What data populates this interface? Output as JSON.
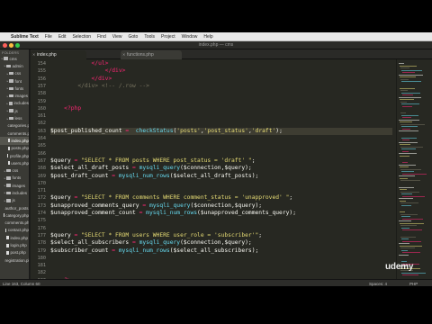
{
  "menubar": {
    "apple": "",
    "items": [
      "Sublime Text",
      "File",
      "Edit",
      "Selection",
      "Find",
      "View",
      "Goto",
      "Tools",
      "Project",
      "Window",
      "Help"
    ]
  },
  "window": {
    "title": "index.php — cms"
  },
  "sidebar": {
    "header": "FOLDERS",
    "items": [
      {
        "label": "cms",
        "kind": "folder",
        "depth": 0,
        "selected": false
      },
      {
        "label": "admin",
        "kind": "folder",
        "depth": 1,
        "selected": false
      },
      {
        "label": "css",
        "kind": "folder",
        "depth": 2,
        "selected": false
      },
      {
        "label": "font",
        "kind": "folder",
        "depth": 2,
        "selected": false
      },
      {
        "label": "fonts",
        "kind": "folder",
        "depth": 2,
        "selected": false
      },
      {
        "label": "images",
        "kind": "folder",
        "depth": 2,
        "selected": false
      },
      {
        "label": "includes",
        "kind": "folder",
        "depth": 2,
        "selected": false
      },
      {
        "label": "js",
        "kind": "folder",
        "depth": 2,
        "selected": false
      },
      {
        "label": "less",
        "kind": "folder",
        "depth": 2,
        "selected": false
      },
      {
        "label": "categories.php",
        "kind": "file",
        "depth": 2,
        "selected": false
      },
      {
        "label": "comments.php",
        "kind": "file",
        "depth": 2,
        "selected": false
      },
      {
        "label": "index.php",
        "kind": "file",
        "depth": 2,
        "selected": true
      },
      {
        "label": "posts.php",
        "kind": "file",
        "depth": 2,
        "selected": false
      },
      {
        "label": "profile.php",
        "kind": "file",
        "depth": 2,
        "selected": false
      },
      {
        "label": "users.php",
        "kind": "file",
        "depth": 2,
        "selected": false
      },
      {
        "label": "css",
        "kind": "folder",
        "depth": 1,
        "selected": false
      },
      {
        "label": "fonts",
        "kind": "folder",
        "depth": 1,
        "selected": false
      },
      {
        "label": "images",
        "kind": "folder",
        "depth": 1,
        "selected": false
      },
      {
        "label": "includes",
        "kind": "folder",
        "depth": 1,
        "selected": false
      },
      {
        "label": "js",
        "kind": "folder",
        "depth": 1,
        "selected": false
      },
      {
        "label": "author_posts.php",
        "kind": "file",
        "depth": 1,
        "selected": false
      },
      {
        "label": "category.php",
        "kind": "file",
        "depth": 1,
        "selected": false
      },
      {
        "label": "comments.php",
        "kind": "file",
        "depth": 1,
        "selected": false
      },
      {
        "label": "contact.php",
        "kind": "file",
        "depth": 1,
        "selected": false
      },
      {
        "label": "index.php",
        "kind": "file",
        "depth": 1,
        "selected": false
      },
      {
        "label": "login.php",
        "kind": "file",
        "depth": 1,
        "selected": false
      },
      {
        "label": "post.php",
        "kind": "file",
        "depth": 1,
        "selected": false
      },
      {
        "label": "registration.php",
        "kind": "file",
        "depth": 1,
        "selected": false
      }
    ]
  },
  "tabs": [
    {
      "label": "index.php",
      "active": true
    },
    {
      "label": "functions.php",
      "active": false
    }
  ],
  "editor": {
    "first_line": 154,
    "highlight_line": 163,
    "lines": [
      {
        "n": "154",
        "parts": [
          [
            "p",
            "            "
          ],
          [
            "t",
            "</ul>"
          ]
        ]
      },
      {
        "n": "155",
        "parts": [
          [
            "p",
            "                "
          ],
          [
            "t",
            "</div>"
          ]
        ]
      },
      {
        "n": "156",
        "parts": [
          [
            "p",
            "            "
          ],
          [
            "t",
            "</div>"
          ]
        ]
      },
      {
        "n": "157",
        "parts": [
          [
            "p",
            "        "
          ],
          [
            "c",
            "</div> <!-- /.row -->"
          ]
        ]
      },
      {
        "n": "158",
        "parts": []
      },
      {
        "n": "159",
        "parts": []
      },
      {
        "n": "160",
        "parts": [
          [
            "p",
            "    "
          ],
          [
            "t",
            "<?php"
          ]
        ]
      },
      {
        "n": "161",
        "parts": []
      },
      {
        "n": "162",
        "parts": []
      },
      {
        "n": "163",
        "parts": [
          [
            "v",
            "$post_published_count "
          ],
          [
            "o",
            "="
          ],
          [
            "p",
            "  "
          ],
          [
            "f",
            "checkStatus"
          ],
          [
            "p",
            "("
          ],
          [
            "s",
            "'posts'"
          ],
          [
            "p",
            ","
          ],
          [
            "s",
            "'post_status'"
          ],
          [
            "p",
            ","
          ],
          [
            "s",
            "'draft'"
          ],
          [
            "p",
            ");"
          ]
        ]
      },
      {
        "n": "164",
        "parts": []
      },
      {
        "n": "165",
        "parts": []
      },
      {
        "n": "166",
        "parts": []
      },
      {
        "n": "167",
        "parts": [
          [
            "v",
            "$query "
          ],
          [
            "o",
            "="
          ],
          [
            "p",
            " "
          ],
          [
            "s",
            "\"SELECT * FROM posts WHERE post_status = 'draft' \""
          ],
          [
            "p",
            ";"
          ]
        ]
      },
      {
        "n": "168",
        "parts": [
          [
            "v",
            "$select_all_draft_posts "
          ],
          [
            "o",
            "="
          ],
          [
            "p",
            " "
          ],
          [
            "f",
            "mysqli_query"
          ],
          [
            "p",
            "($connection,$query);"
          ]
        ]
      },
      {
        "n": "169",
        "parts": [
          [
            "v",
            "$post_draft_count "
          ],
          [
            "o",
            "="
          ],
          [
            "p",
            " "
          ],
          [
            "f",
            "mysqli_num_rows"
          ],
          [
            "p",
            "($select_all_draft_posts);"
          ]
        ]
      },
      {
        "n": "170",
        "parts": []
      },
      {
        "n": "171",
        "parts": []
      },
      {
        "n": "172",
        "parts": [
          [
            "v",
            "$query "
          ],
          [
            "o",
            "="
          ],
          [
            "p",
            " "
          ],
          [
            "s",
            "\"SELECT * FROM comments WHERE comment_status = 'unapproved' \""
          ],
          [
            "p",
            ";"
          ]
        ]
      },
      {
        "n": "173",
        "parts": [
          [
            "v",
            "$unapproved_comments_query "
          ],
          [
            "o",
            "="
          ],
          [
            "p",
            " "
          ],
          [
            "f",
            "mysqli_query"
          ],
          [
            "p",
            "($connection,$query);"
          ]
        ]
      },
      {
        "n": "174",
        "parts": [
          [
            "v",
            "$unapproved_comment_count "
          ],
          [
            "o",
            "="
          ],
          [
            "p",
            " "
          ],
          [
            "f",
            "mysqli_num_rows"
          ],
          [
            "p",
            "($unapproved_comments_query);"
          ]
        ]
      },
      {
        "n": "175",
        "parts": []
      },
      {
        "n": "176",
        "parts": []
      },
      {
        "n": "177",
        "parts": [
          [
            "v",
            "$query "
          ],
          [
            "o",
            "="
          ],
          [
            "p",
            " "
          ],
          [
            "s",
            "\"SELECT * FROM users WHERE user_role = 'subscriber'\""
          ],
          [
            "p",
            ";"
          ]
        ]
      },
      {
        "n": "178",
        "parts": [
          [
            "v",
            "$select_all_subscribers "
          ],
          [
            "o",
            "="
          ],
          [
            "p",
            " "
          ],
          [
            "f",
            "mysqli_query"
          ],
          [
            "p",
            "($connection,$query);"
          ]
        ]
      },
      {
        "n": "179",
        "parts": [
          [
            "v",
            "$subscriber_count "
          ],
          [
            "o",
            "="
          ],
          [
            "p",
            " "
          ],
          [
            "f",
            "mysqli_num_rows"
          ],
          [
            "p",
            "($select_all_subscribers);"
          ]
        ]
      },
      {
        "n": "180",
        "parts": []
      },
      {
        "n": "181",
        "parts": []
      },
      {
        "n": "182",
        "parts": []
      },
      {
        "n": "183",
        "parts": [
          [
            "p",
            "    "
          ],
          [
            "t",
            "?>"
          ]
        ]
      },
      {
        "n": "184",
        "parts": []
      },
      {
        "n": "185",
        "parts": []
      }
    ]
  },
  "status": {
    "position": "Line 163, Column 60",
    "spaces": "Spaces: 4",
    "language": "PHP"
  },
  "watermark": "udemy",
  "colors": {
    "background": "#272822",
    "string": "#e6db74",
    "function": "#66d9ef",
    "keyword": "#f92672",
    "comment": "#75715e"
  }
}
